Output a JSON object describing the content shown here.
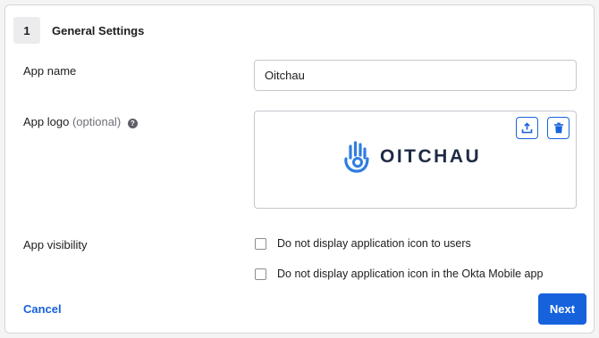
{
  "section": {
    "step_number": "1",
    "title": "General Settings"
  },
  "fields": {
    "app_name": {
      "label": "App name",
      "value": "Oitchau"
    },
    "app_logo": {
      "label": "App logo",
      "optional_text": "(optional)",
      "help_icon": "question-circle-icon",
      "upload_icon": "upload-icon",
      "delete_icon": "trash-icon",
      "logo_text": "OITCHAU",
      "logo_color": "#2f7de1"
    },
    "app_visibility": {
      "label": "App visibility",
      "options": [
        {
          "label": "Do not display application icon to users",
          "checked": false
        },
        {
          "label": "Do not display application icon in the Okta Mobile app",
          "checked": false
        }
      ]
    }
  },
  "actions": {
    "cancel_label": "Cancel",
    "next_label": "Next"
  },
  "colors": {
    "primary": "#1662dd",
    "border": "#c7c7cf",
    "step_badge_bg": "#ececee"
  }
}
